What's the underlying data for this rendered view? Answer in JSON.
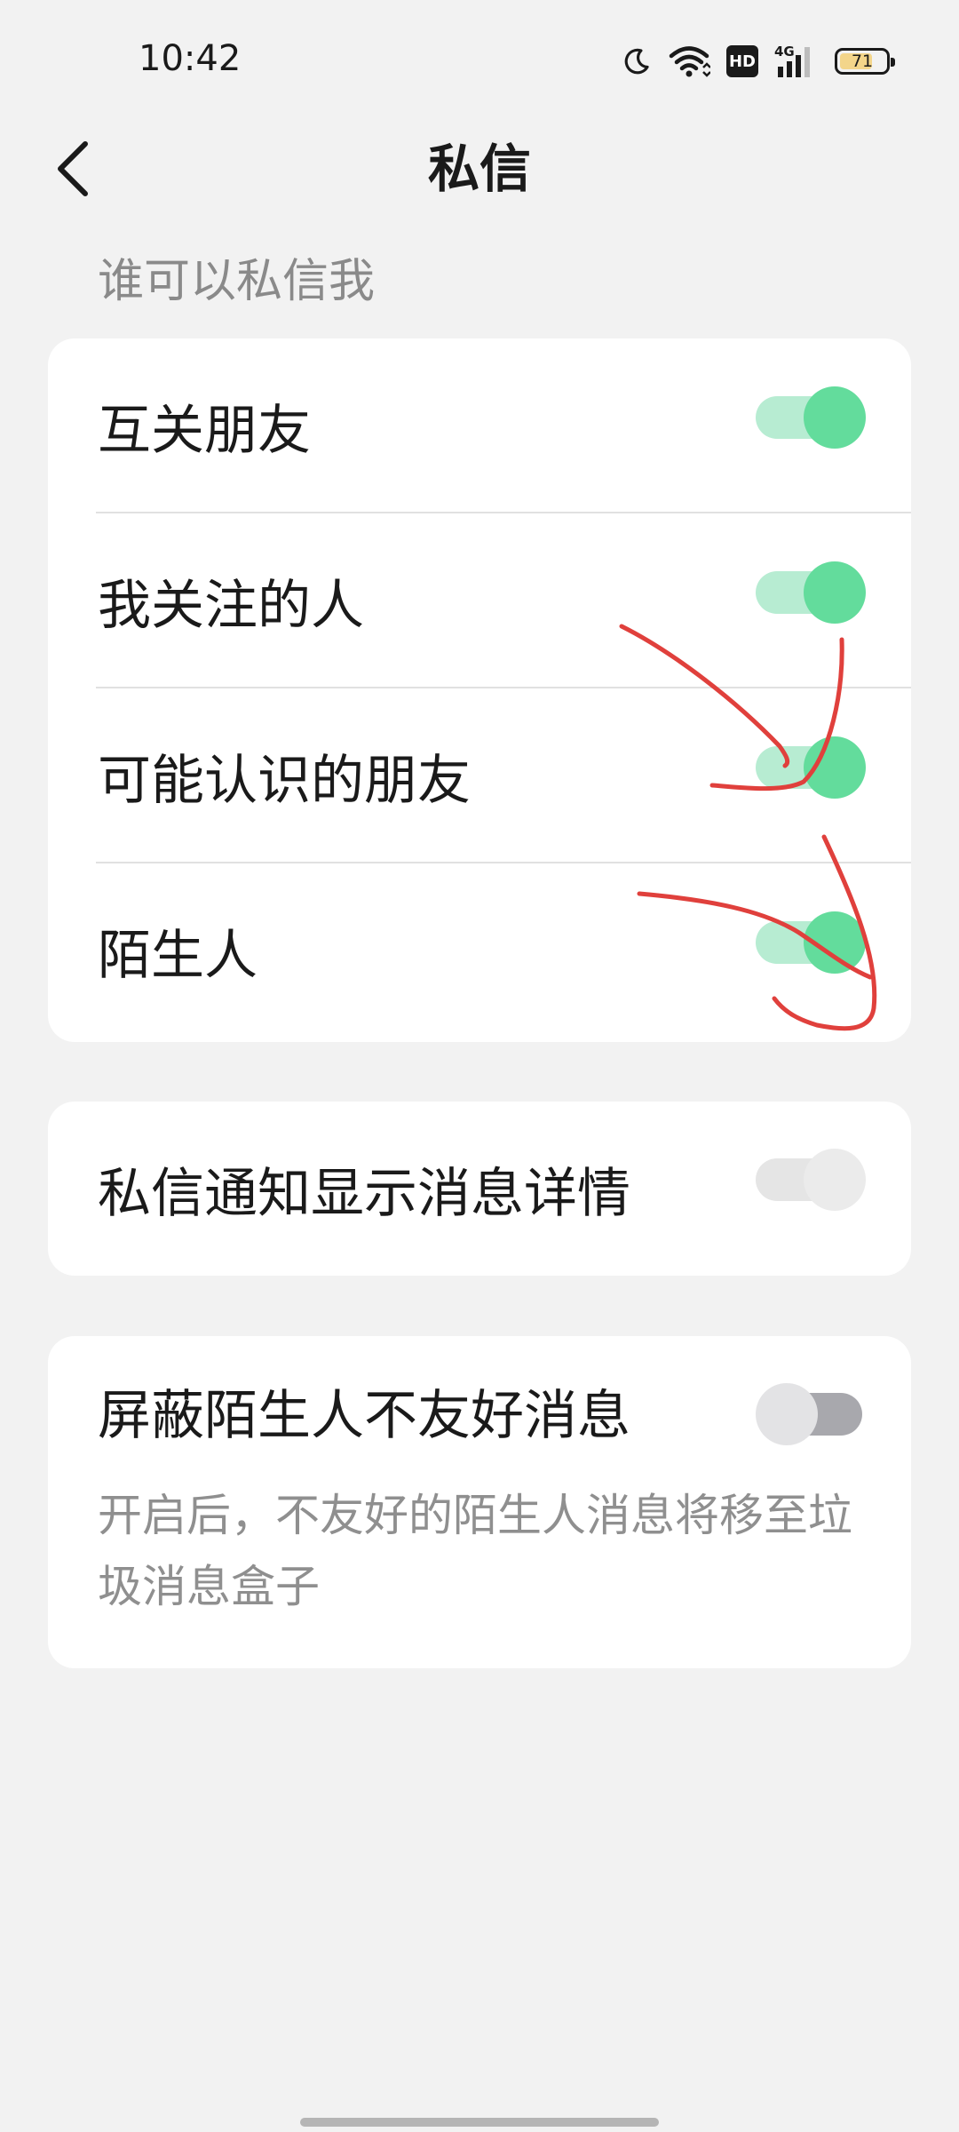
{
  "status_bar": {
    "time": "10:42",
    "hd_label": "HD",
    "network_label": "4G",
    "battery_level": "71",
    "icons": [
      "moon-icon",
      "wifi-icon",
      "hd-icon",
      "signal-icon",
      "battery-icon"
    ]
  },
  "header": {
    "title": "私信",
    "back_icon": "chevron-left-icon"
  },
  "who_can_message": {
    "label": "谁可以私信我",
    "items": [
      {
        "label": "互关朋友",
        "enabled": true
      },
      {
        "label": "我关注的人",
        "enabled": true
      },
      {
        "label": "可能认识的朋友",
        "enabled": true
      },
      {
        "label": "陌生人",
        "enabled": true
      }
    ]
  },
  "notification_detail": {
    "label": "私信通知显示消息详情",
    "enabled": false
  },
  "block_unfriendly": {
    "label": "屏蔽陌生人不友好消息",
    "description": "开启后，不友好的陌生人消息将移至垃圾消息盒子",
    "enabled": false
  },
  "colors": {
    "toggle_on_knob": "#63dc9c",
    "toggle_on_track": "#b7ecd2",
    "annotation_stroke": "#e0403c",
    "background": "#f2f2f2"
  }
}
